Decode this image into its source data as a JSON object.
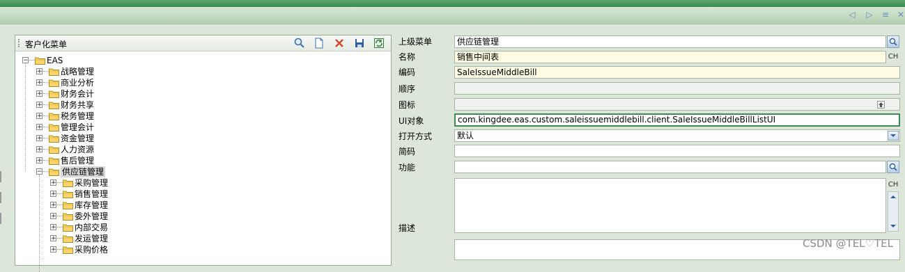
{
  "window": {
    "nav_icons": [
      "arrow-left-icon",
      "arrow-right-icon",
      "list-icon",
      "close-icon"
    ]
  },
  "left_panel": {
    "title": "客户化菜单",
    "toolbar_icons": [
      "search-icon",
      "new-document-icon",
      "delete-icon",
      "save-icon",
      "refresh-icon"
    ]
  },
  "tree": {
    "root": "EAS",
    "level1": [
      "战略管理",
      "商业分析",
      "财务会计",
      "财务共享",
      "税务管理",
      "管理会计",
      "资金管理",
      "人力资源",
      "售后管理",
      "供应链管理"
    ],
    "selected": "供应链管理",
    "level2": [
      "采购管理",
      "销售管理",
      "库存管理",
      "委外管理",
      "内部交易",
      "发运管理",
      "采购价格"
    ]
  },
  "form": {
    "parent_menu": {
      "label": "上级菜单",
      "value": "供应链管理"
    },
    "name": {
      "label": "名称",
      "value": "销售中间表",
      "lang_btn": "CH"
    },
    "code": {
      "label": "编码",
      "value": "SaleIssueMiddleBill"
    },
    "order": {
      "label": "顺序",
      "value": ""
    },
    "icon": {
      "label": "图标",
      "value": ""
    },
    "ui_object": {
      "label": "UI对象",
      "value": "com.kingdee.eas.custom.saleissuemiddlebill.client.SaleIssueMiddleBillListUI"
    },
    "open_mode": {
      "label": "打开方式",
      "value": "默认"
    },
    "mnemonic": {
      "label": "简码",
      "value": ""
    },
    "function": {
      "label": "功能",
      "value": ""
    },
    "description": {
      "label": "描述",
      "value": "",
      "lang_btn": "CH"
    }
  },
  "watermark": "CSDN @TEL♡TEL",
  "colors": {
    "accent_green": "#3f8a52",
    "yellow_field": "#fefbe3"
  }
}
